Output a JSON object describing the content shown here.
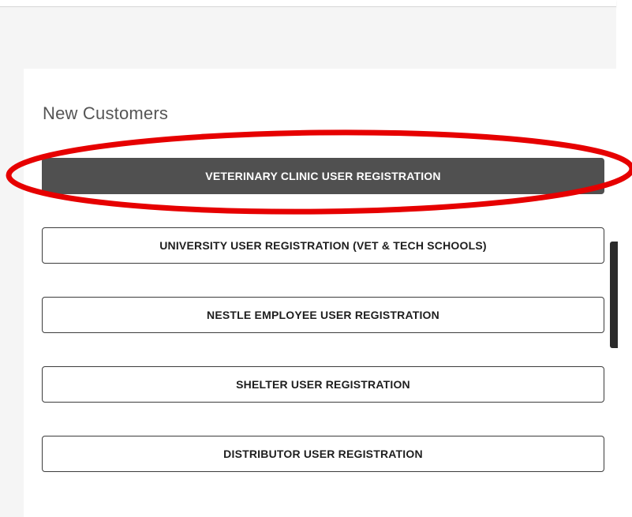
{
  "section": {
    "title": "New Customers"
  },
  "buttons": [
    {
      "label": "VETERINARY CLINIC USER REGISTRATION",
      "highlighted": true
    },
    {
      "label": "UNIVERSITY USER REGISTRATION (VET & TECH SCHOOLS)",
      "highlighted": false
    },
    {
      "label": "NESTLE EMPLOYEE USER REGISTRATION",
      "highlighted": false
    },
    {
      "label": "SHELTER USER REGISTRATION",
      "highlighted": false
    },
    {
      "label": "DISTRIBUTOR USER REGISTRATION",
      "highlighted": false
    }
  ],
  "colors": {
    "primary_button_bg": "#505050",
    "annotation_circle": "#e60000",
    "page_gray": "#f5f5f5"
  }
}
